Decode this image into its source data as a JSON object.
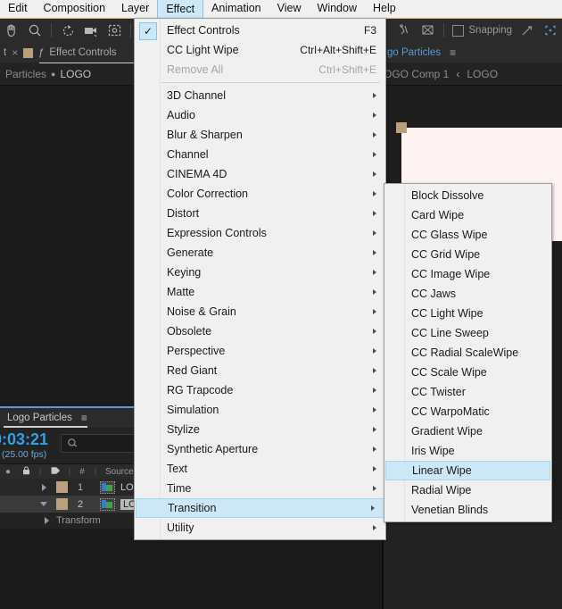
{
  "menubar": {
    "items": [
      {
        "label": "Edit",
        "active": false
      },
      {
        "label": "Composition",
        "active": false
      },
      {
        "label": "Layer",
        "active": false
      },
      {
        "label": "Effect",
        "active": true
      },
      {
        "label": "Animation",
        "active": false
      },
      {
        "label": "View",
        "active": false
      },
      {
        "label": "Window",
        "active": false
      },
      {
        "label": "Help",
        "active": false
      }
    ]
  },
  "toolbar": {
    "snapping_label": "Snapping",
    "icons": [
      "hand-tool",
      "zoom-tool",
      "rotation-tool",
      "camera-tool",
      "region-of-interest-tool",
      "mask-rect-tool",
      "puppet-pin-tool",
      "roto-brush-tool",
      "align-tool",
      "shape-tool"
    ]
  },
  "left_panel": {
    "tab_title": "Effect Controls",
    "close_glyph": "×",
    "lock_glyph": "ƒ",
    "breadcrumb_left": "Particles",
    "breadcrumb_dot": "●",
    "breadcrumb_right": "LOGO"
  },
  "right_panel": {
    "tab_title": "go Particles",
    "menu_glyph": "≡",
    "breadcrumb_comp": "OGO Comp 1",
    "breadcrumb_arrow": "‹",
    "breadcrumb_layer": "LOGO"
  },
  "timeline": {
    "tab_title": "Logo Particles",
    "menu_glyph": "≡",
    "current_time": "0:03:21",
    "fps": "(25.00 fps)",
    "search_placeholder": "",
    "search_icon": "search-icon",
    "columns": [
      "●",
      "🔒",
      "🏷",
      "#",
      "Source Name"
    ],
    "col_lock": "🔒",
    "col_tag": "🏷",
    "col_num": "#",
    "col_source": "Source Name",
    "rows": [
      {
        "index": "1",
        "name": "LOGO",
        "expanded": false
      },
      {
        "index": "2",
        "name": "LOGO",
        "expanded": true
      }
    ],
    "sub_row": "Transform"
  },
  "effect_menu": {
    "header_items": [
      {
        "label": "Effect Controls",
        "shortcut": "F3",
        "checked": true,
        "disabled": false,
        "submenu": false
      },
      {
        "label": "CC Light Wipe",
        "shortcut": "Ctrl+Alt+Shift+E",
        "checked": false,
        "disabled": false,
        "submenu": false
      },
      {
        "label": "Remove All",
        "shortcut": "Ctrl+Shift+E",
        "checked": false,
        "disabled": true,
        "submenu": false
      }
    ],
    "category_items": [
      {
        "label": "3D Channel",
        "submenu": true,
        "highlight": false
      },
      {
        "label": "Audio",
        "submenu": true,
        "highlight": false
      },
      {
        "label": "Blur & Sharpen",
        "submenu": true,
        "highlight": false
      },
      {
        "label": "Channel",
        "submenu": true,
        "highlight": false
      },
      {
        "label": "CINEMA 4D",
        "submenu": true,
        "highlight": false
      },
      {
        "label": "Color Correction",
        "submenu": true,
        "highlight": false
      },
      {
        "label": "Distort",
        "submenu": true,
        "highlight": false
      },
      {
        "label": "Expression Controls",
        "submenu": true,
        "highlight": false
      },
      {
        "label": "Generate",
        "submenu": true,
        "highlight": false
      },
      {
        "label": "Keying",
        "submenu": true,
        "highlight": false
      },
      {
        "label": "Matte",
        "submenu": true,
        "highlight": false
      },
      {
        "label": "Noise & Grain",
        "submenu": true,
        "highlight": false
      },
      {
        "label": "Obsolete",
        "submenu": true,
        "highlight": false
      },
      {
        "label": "Perspective",
        "submenu": true,
        "highlight": false
      },
      {
        "label": "Red Giant",
        "submenu": true,
        "highlight": false
      },
      {
        "label": "RG Trapcode",
        "submenu": true,
        "highlight": false
      },
      {
        "label": "Simulation",
        "submenu": true,
        "highlight": false
      },
      {
        "label": "Stylize",
        "submenu": true,
        "highlight": false
      },
      {
        "label": "Synthetic Aperture",
        "submenu": true,
        "highlight": false
      },
      {
        "label": "Text",
        "submenu": true,
        "highlight": false
      },
      {
        "label": "Time",
        "submenu": true,
        "highlight": false
      },
      {
        "label": "Transition",
        "submenu": true,
        "highlight": true
      },
      {
        "label": "Utility",
        "submenu": true,
        "highlight": false
      }
    ]
  },
  "transition_menu": {
    "items": [
      {
        "label": "Block Dissolve",
        "highlight": false
      },
      {
        "label": "Card Wipe",
        "highlight": false
      },
      {
        "label": "CC Glass Wipe",
        "highlight": false
      },
      {
        "label": "CC Grid Wipe",
        "highlight": false
      },
      {
        "label": "CC Image Wipe",
        "highlight": false
      },
      {
        "label": "CC Jaws",
        "highlight": false
      },
      {
        "label": "CC Light Wipe",
        "highlight": false
      },
      {
        "label": "CC Line Sweep",
        "highlight": false
      },
      {
        "label": "CC Radial ScaleWipe",
        "highlight": false
      },
      {
        "label": "CC Scale Wipe",
        "highlight": false
      },
      {
        "label": "CC Twister",
        "highlight": false
      },
      {
        "label": "CC WarpoMatic",
        "highlight": false
      },
      {
        "label": "Gradient Wipe",
        "highlight": false
      },
      {
        "label": "Iris Wipe",
        "highlight": false
      },
      {
        "label": "Linear Wipe",
        "highlight": true
      },
      {
        "label": "Radial Wipe",
        "highlight": false
      },
      {
        "label": "Venetian Blinds",
        "highlight": false
      }
    ]
  },
  "colors": {
    "menu_bg": "#f0f0f0",
    "menu_highlight": "#cce8f7",
    "menu_highlight_border": "#a9d4ef",
    "accent_blue": "#5b9bd5",
    "time_blue": "#2ea1e8",
    "swatch_tan": "#b9a07b",
    "app_bg": "#232323",
    "canvas_bg": "#fdf3f3"
  }
}
